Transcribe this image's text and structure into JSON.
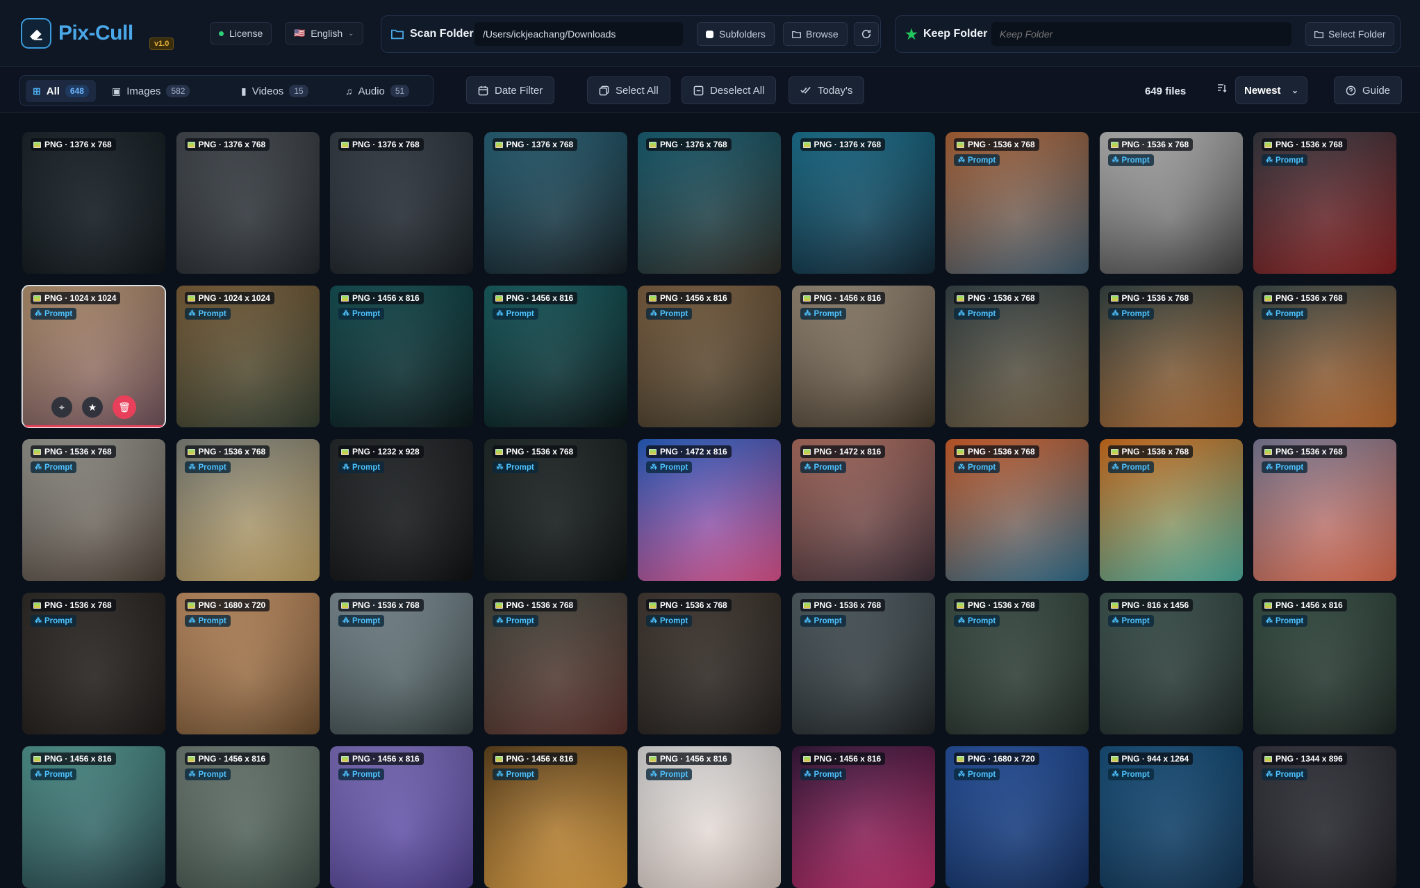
{
  "app": {
    "name": "Pix-Cull",
    "version": "v1.0"
  },
  "header": {
    "license_label": "License",
    "language_flag": "🇺🇸",
    "language_label": "English",
    "scan": {
      "label": "Scan Folder",
      "path": "/Users/ickjeachang/Downloads",
      "subfolders_label": "Subfolders",
      "browse_label": "Browse"
    },
    "keep": {
      "label": "Keep Folder",
      "placeholder": "Keep Folder",
      "select_label": "Select Folder"
    }
  },
  "toolbar": {
    "tabs": [
      {
        "label": "All",
        "count": "648"
      },
      {
        "label": "Images",
        "count": "582"
      },
      {
        "label": "Videos",
        "count": "15"
      },
      {
        "label": "Audio",
        "count": "51"
      }
    ],
    "date_filter_label": "Date Filter",
    "select_all_label": "Select All",
    "deselect_all_label": "Deselect All",
    "todays_label": "Today's",
    "file_count": "649 files",
    "sort_value": "Newest",
    "guide_label": "Guide"
  },
  "prompt_label": "Prompt",
  "tiles": [
    {
      "badge": "PNG · 1376 x 768",
      "prompt": false,
      "c1": "#1f2a30",
      "c2": "#0b1116"
    },
    {
      "badge": "PNG · 1376 x 768",
      "prompt": false,
      "c1": "#4b5158",
      "c2": "#1e2328"
    },
    {
      "badge": "PNG · 1376 x 768",
      "prompt": false,
      "c1": "#3c4650",
      "c2": "#14191e"
    },
    {
      "badge": "PNG · 1376 x 768",
      "prompt": false,
      "c1": "#2c6e86",
      "c2": "#10181d"
    },
    {
      "badge": "PNG · 1376 x 768",
      "prompt": false,
      "c1": "#1b6a80",
      "c2": "#2a2822"
    },
    {
      "badge": "PNG · 1376 x 768",
      "prompt": false,
      "c1": "#1e7fa0",
      "c2": "#0d2230"
    },
    {
      "badge": "PNG · 1536 x 768",
      "prompt": true,
      "c1": "#c2703e",
      "c2": "#3d5a6e"
    },
    {
      "badge": "PNG · 1536 x 768",
      "prompt": true,
      "c1": "#cfcfcf",
      "c2": "#3c3c3c"
    },
    {
      "badge": "PNG · 1536 x 768",
      "prompt": true,
      "c1": "#3b3f48",
      "c2": "#8a1c1c"
    },
    {
      "badge": "PNG · 1024 x 1024",
      "prompt": true,
      "c1": "#c7a27a",
      "c2": "#6e4f59"
    },
    {
      "badge": "PNG · 1024 x 1024",
      "prompt": true,
      "c1": "#8a6a40",
      "c2": "#2f3a2c"
    },
    {
      "badge": "PNG · 1456 x 816",
      "prompt": true,
      "c1": "#185a5e",
      "c2": "#061315"
    },
    {
      "badge": "PNG · 1456 x 816",
      "prompt": true,
      "c1": "#1b6a6e",
      "c2": "#041012"
    },
    {
      "badge": "PNG · 1456 x 816",
      "prompt": true,
      "c1": "#8a6a48",
      "c2": "#3a3324"
    },
    {
      "badge": "PNG · 1456 x 816",
      "prompt": true,
      "c1": "#aa9a86",
      "c2": "#3e3324"
    },
    {
      "badge": "PNG · 1536 x 768",
      "prompt": true,
      "c1": "#3a4a4e",
      "c2": "#6e5a3e"
    },
    {
      "badge": "PNG · 1536 x 768",
      "prompt": true,
      "c1": "#3a4a48",
      "c2": "#b06a30"
    },
    {
      "badge": "PNG · 1536 x 768",
      "prompt": true,
      "c1": "#40504e",
      "c2": "#c06a2c"
    },
    {
      "badge": "PNG · 1536 x 768",
      "prompt": true,
      "c1": "#a8a8a0",
      "c2": "#4a3e34"
    },
    {
      "badge": "PNG · 1536 x 768",
      "prompt": true,
      "c1": "#8c9088",
      "c2": "#c0a060"
    },
    {
      "badge": "PNG · 1232 x 928",
      "prompt": true,
      "c1": "#2a2e30",
      "c2": "#0a0c0d"
    },
    {
      "badge": "PNG · 1536 x 768",
      "prompt": true,
      "c1": "#26302e",
      "c2": "#0a0e0e"
    },
    {
      "badge": "PNG · 1472 x 816",
      "prompt": true,
      "c1": "#2a6ad8",
      "c2": "#e0508a"
    },
    {
      "badge": "PNG · 1472 x 816",
      "prompt": true,
      "c1": "#c07a6a",
      "c2": "#3a2a34"
    },
    {
      "badge": "PNG · 1536 x 768",
      "prompt": true,
      "c1": "#e86a30",
      "c2": "#2a6a8a"
    },
    {
      "badge": "PNG · 1536 x 768",
      "prompt": true,
      "c1": "#e87a20",
      "c2": "#4ab0a0"
    },
    {
      "badge": "PNG · 1536 x 768",
      "prompt": true,
      "c1": "#8a8aa8",
      "c2": "#e06a4a"
    },
    {
      "badge": "PNG · 1536 x 768",
      "prompt": true,
      "c1": "#34302c",
      "c2": "#1a1614"
    },
    {
      "badge": "PNG · 1680 x 720",
      "prompt": true,
      "c1": "#d8a070",
      "c2": "#6a4a2a"
    },
    {
      "badge": "PNG · 1536 x 768",
      "prompt": true,
      "c1": "#8ea0a8",
      "c2": "#2e3a3a"
    },
    {
      "badge": "PNG · 1536 x 768",
      "prompt": true,
      "c1": "#4a5046",
      "c2": "#5a2e28"
    },
    {
      "badge": "PNG · 1536 x 768",
      "prompt": true,
      "c1": "#4a4038",
      "c2": "#1e1a18"
    },
    {
      "badge": "PNG · 1536 x 768",
      "prompt": true,
      "c1": "#5a6a70",
      "c2": "#1a1e20"
    },
    {
      "badge": "PNG · 1536 x 768",
      "prompt": true,
      "c1": "#445a50",
      "c2": "#202a24"
    },
    {
      "badge": "PNG · 816 x 1456",
      "prompt": true,
      "c1": "#46605a",
      "c2": "#1a2422"
    },
    {
      "badge": "PNG · 1456 x 816",
      "prompt": true,
      "c1": "#3e5a4e",
      "c2": "#1a2420"
    },
    {
      "badge": "PNG · 1456 x 816",
      "prompt": true,
      "c1": "#5aa8a0",
      "c2": "#1e3a40"
    },
    {
      "badge": "PNG · 1456 x 816",
      "prompt": true,
      "c1": "#7a8a80",
      "c2": "#3a4a44"
    },
    {
      "badge": "PNG · 1456 x 816",
      "prompt": true,
      "c1": "#8a7ad0",
      "c2": "#4a3a8a"
    },
    {
      "badge": "PNG · 1456 x 816",
      "prompt": true,
      "c1": "#6a4a20",
      "c2": "#e0a040"
    },
    {
      "badge": "PNG · 1456 x 816",
      "prompt": true,
      "c1": "#f4f4f4",
      "c2": "#d8c8c0"
    },
    {
      "badge": "PNG · 1456 x 816",
      "prompt": true,
      "c1": "#3a1a40",
      "c2": "#c02a6a"
    },
    {
      "badge": "PNG · 1680 x 720",
      "prompt": true,
      "c1": "#2a5ab0",
      "c2": "#0e2a5a"
    },
    {
      "badge": "PNG · 944 x 1264",
      "prompt": true,
      "c1": "#1a5a8a",
      "c2": "#0e3050"
    },
    {
      "badge": "PNG · 1344 x 896",
      "prompt": true,
      "c1": "#3a3a44",
      "c2": "#1a1a20"
    }
  ]
}
